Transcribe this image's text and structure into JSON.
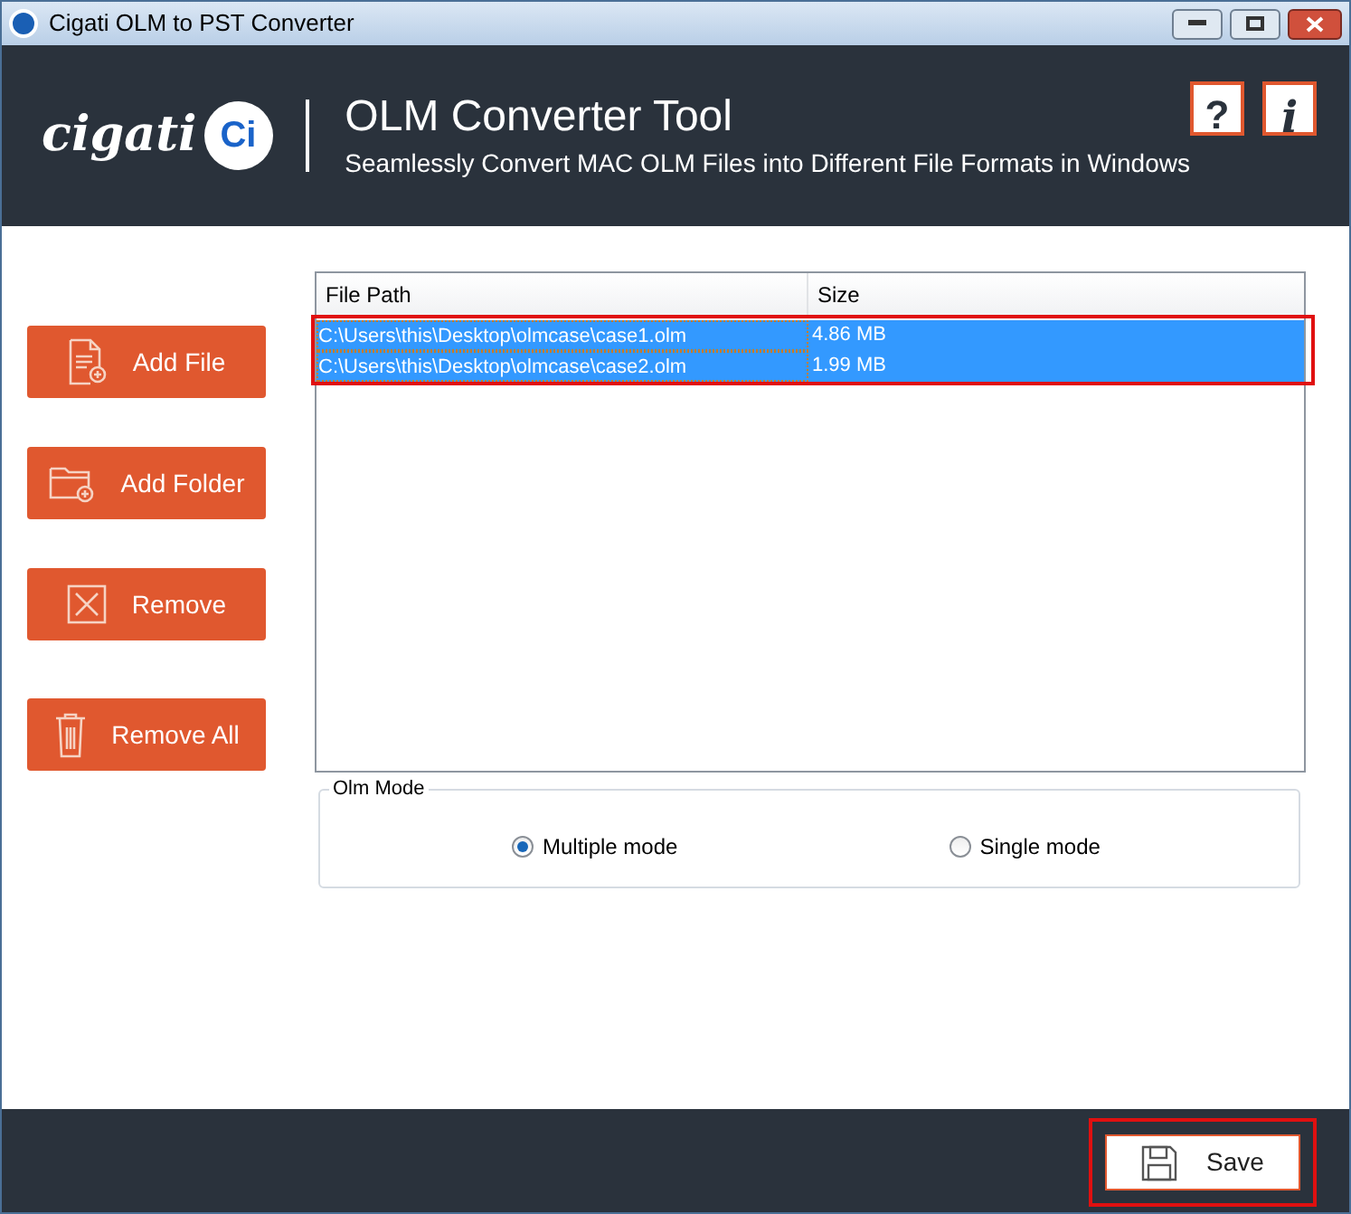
{
  "window": {
    "title": "Cigati OLM to PST Converter"
  },
  "header": {
    "logo_text": "cigati",
    "logo_badge": "Ci",
    "title": "OLM Converter Tool",
    "subtitle": "Seamlessly Convert MAC OLM Files into Different File Formats in Windows",
    "help_button": "?",
    "info_button": "i"
  },
  "actions": [
    {
      "label": "Add File",
      "kind": "file"
    },
    {
      "label": "Add Folder",
      "kind": "folder"
    },
    {
      "label": "Remove",
      "kind": "remove"
    },
    {
      "label": "Remove All",
      "kind": "trash"
    }
  ],
  "table": {
    "columns": [
      "File Path",
      "Size"
    ],
    "rows": [
      {
        "cells": [
          "C:\\Users\\this\\Desktop\\olmcase\\case1.olm",
          "4.86 MB"
        ],
        "selected": true
      },
      {
        "cells": [
          "C:\\Users\\this\\Desktop\\olmcase\\case2.olm",
          "1.99 MB"
        ],
        "selected": true
      }
    ]
  },
  "olm_mode": {
    "legend": "Olm Mode",
    "options": [
      {
        "label": "Multiple mode",
        "selected": true
      },
      {
        "label": "Single mode",
        "selected": false
      }
    ]
  },
  "footer": {
    "save_button": "Save"
  }
}
